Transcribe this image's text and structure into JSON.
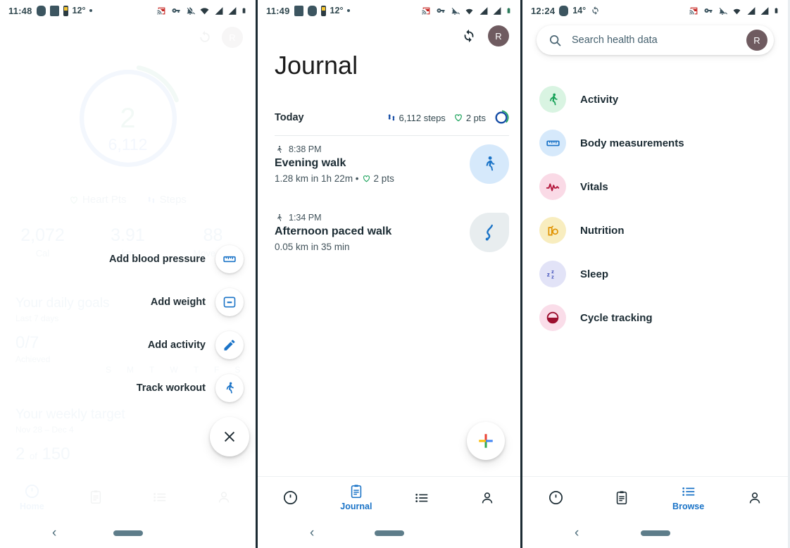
{
  "colors": {
    "blue": "#1a73c7",
    "dark_blue": "#174ea6",
    "green": "#1a8f5f",
    "status_text": "#31484f",
    "avatar_bg": "#6f5b60"
  },
  "panel1": {
    "statusbar": {
      "time": "11:48",
      "temp": "12°"
    },
    "ring": {
      "heart_pts": "2",
      "steps": "6,112"
    },
    "legend": [
      {
        "label": "Heart Pts",
        "icon": "heart-icon"
      },
      {
        "label": "Steps",
        "icon": "steps-icon"
      }
    ],
    "stats": [
      {
        "value": "2,072",
        "label": "Cal"
      },
      {
        "value": "3.91",
        "label": "km"
      },
      {
        "value": "88",
        "label": "Move Min"
      }
    ],
    "daily_goals": {
      "heading": "Your daily goals",
      "sub": "Last 7 days",
      "big": "0/7",
      "caption": "Achieved",
      "days": [
        "S",
        "M",
        "T",
        "W",
        "T",
        "F",
        "S"
      ]
    },
    "weekly_target": {
      "heading": "Your weekly target",
      "sub": "Nov 28 – Dec 4",
      "big_value": "2",
      "big_of": "of",
      "big_total": "150"
    },
    "speed_dial": [
      {
        "label": "Add blood pressure",
        "icon": "ruler-icon"
      },
      {
        "label": "Add weight",
        "icon": "scale-icon"
      },
      {
        "label": "Add activity",
        "icon": "pencil-icon"
      },
      {
        "label": "Track workout",
        "icon": "running-icon"
      }
    ],
    "close_label": "✕",
    "bottom_nav": [
      {
        "label": "Home",
        "icon": "home-ring-icon",
        "active": true
      },
      {
        "label": "",
        "icon": "journal-clipboard-icon",
        "active": false
      },
      {
        "label": "",
        "icon": "browse-list-icon",
        "active": false
      },
      {
        "label": "",
        "icon": "profile-person-icon",
        "active": false
      }
    ]
  },
  "panel2": {
    "statusbar": {
      "time": "11:49",
      "temp": "12°"
    },
    "avatar_initial": "R",
    "title": "Journal",
    "today_label": "Today",
    "today_metrics": [
      {
        "icon": "steps-icon",
        "text": "6,112 steps"
      },
      {
        "icon": "heart-icon",
        "text": "2 pts"
      }
    ],
    "entries": [
      {
        "time": "8:38 PM",
        "title": "Evening walk",
        "subtitle": "1.28 km in 1h 22m •",
        "points": "2 pts",
        "thumb": "walking-icon"
      },
      {
        "time": "1:34 PM",
        "title": "Afternoon paced walk",
        "subtitle": "0.05 km in 35 min",
        "points": "",
        "thumb": "map-route-icon"
      }
    ],
    "fab_icon": "add-plus-icon",
    "bottom_nav": [
      {
        "label": "",
        "icon": "home-ring-icon",
        "active": false
      },
      {
        "label": "Journal",
        "icon": "journal-clipboard-icon",
        "active": true
      },
      {
        "label": "",
        "icon": "browse-list-icon",
        "active": false
      },
      {
        "label": "",
        "icon": "profile-person-icon",
        "active": false
      }
    ]
  },
  "panel3": {
    "statusbar": {
      "time": "12:24",
      "temp": "14°"
    },
    "search": {
      "placeholder": "Search health data",
      "value": ""
    },
    "avatar_initial": "R",
    "items": [
      {
        "label": "Activity",
        "icon": "running-icon",
        "bg": "#d9f4e2",
        "fg": "#17a158"
      },
      {
        "label": "Body measurements",
        "icon": "ruler-icon",
        "bg": "#d6e9fb",
        "fg": "#1a73c7"
      },
      {
        "label": "Vitals",
        "icon": "pulse-icon",
        "bg": "#fadae6",
        "fg": "#b3173c"
      },
      {
        "label": "Nutrition",
        "icon": "nutrition-icon",
        "bg": "#f8edbf",
        "fg": "#e09200"
      },
      {
        "label": "Sleep",
        "icon": "sleep-zzz-icon",
        "bg": "#e2e3f7",
        "fg": "#3b4bb8"
      },
      {
        "label": "Cycle tracking",
        "icon": "cycle-icon",
        "bg": "#fadde9",
        "fg": "#9c0e2e"
      }
    ],
    "bottom_nav": [
      {
        "label": "",
        "icon": "home-ring-icon",
        "active": false
      },
      {
        "label": "",
        "icon": "journal-clipboard-icon",
        "active": false
      },
      {
        "label": "Browse",
        "icon": "browse-list-icon",
        "active": true
      },
      {
        "label": "",
        "icon": "profile-person-icon",
        "active": false
      }
    ]
  }
}
